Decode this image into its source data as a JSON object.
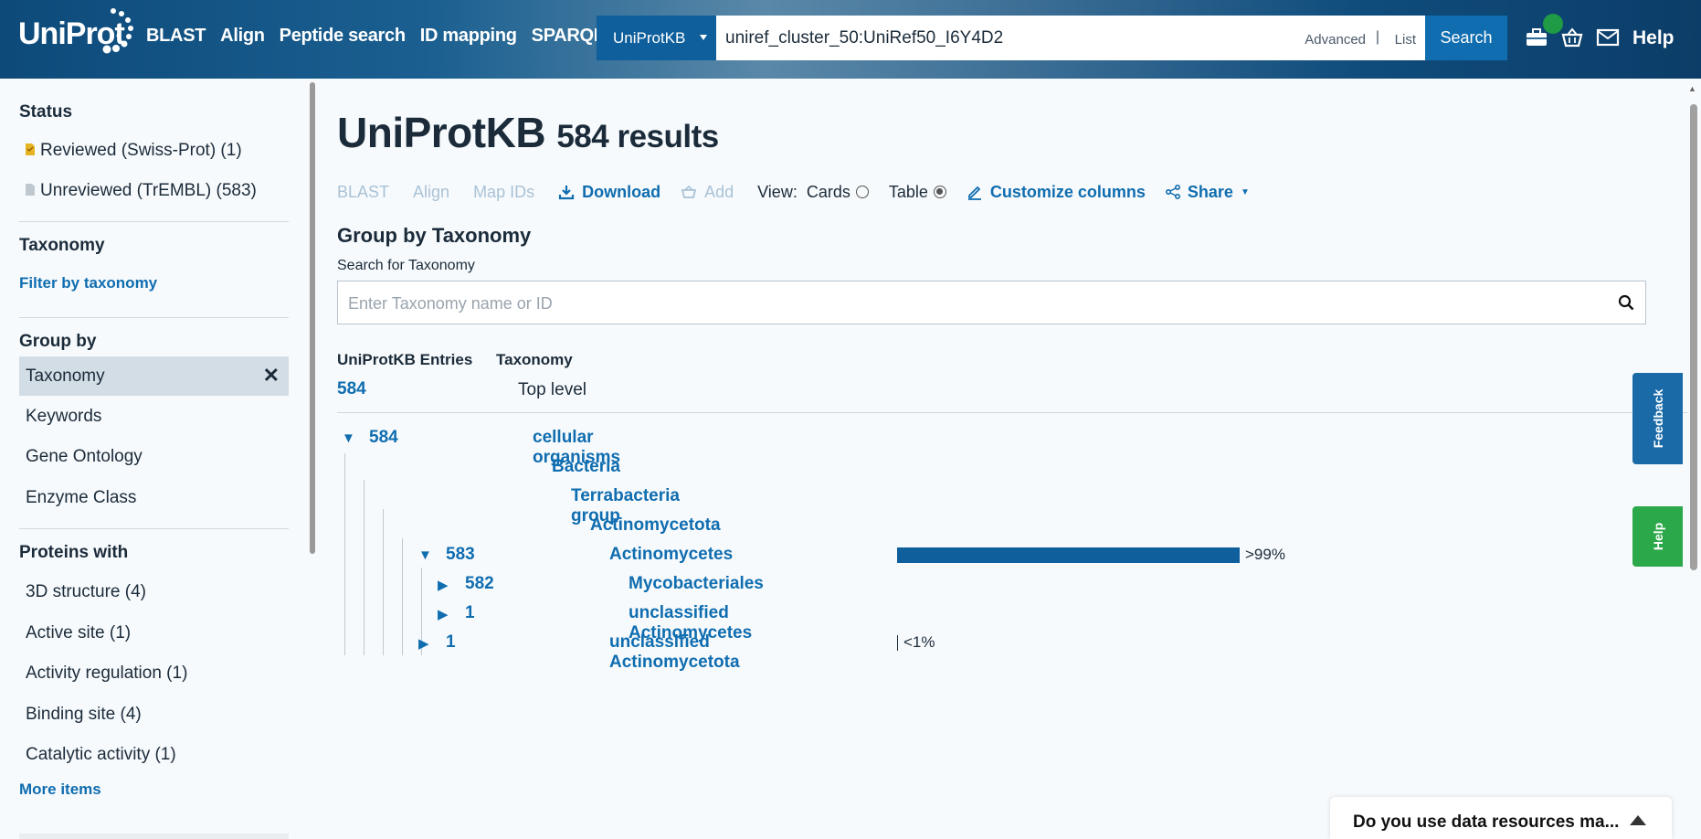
{
  "header": {
    "logo": "UniProt",
    "nav": [
      "BLAST",
      "Align",
      "Peptide search",
      "ID mapping",
      "SPARQL"
    ],
    "database": "UniProtKB",
    "query": "uniref_cluster_50:UniRef50_I6Y4D2",
    "advanced": "Advanced",
    "separator": "|",
    "list": "List",
    "search_button": "Search",
    "help": "Help",
    "icons": [
      "toolkit-icon",
      "basket-icon",
      "mail-icon"
    ]
  },
  "sidebar": {
    "status_heading": "Status",
    "status_items": [
      "Reviewed (Swiss-Prot) (1)",
      "Unreviewed (TrEMBL) (583)"
    ],
    "taxonomy_heading": "Taxonomy",
    "filter_link": "Filter by taxonomy",
    "group_by_heading": "Group by",
    "group_by_active": "Taxonomy",
    "group_by_items": [
      "Keywords",
      "Gene Ontology",
      "Enzyme Class"
    ],
    "proteins_heading": "Proteins with",
    "protein_items": [
      "3D structure (4)",
      "Active site (1)",
      "Activity regulation (1)",
      "Binding site (4)",
      "Catalytic activity (1)"
    ],
    "more_items": "More items"
  },
  "main": {
    "title": "UniProtKB",
    "results": "584 results",
    "toolbar": {
      "blast": "BLAST",
      "align": "Align",
      "map_ids": "Map IDs",
      "download": "Download",
      "add": "Add",
      "view": "View:",
      "cards": "Cards",
      "table": "Table",
      "customize": "Customize columns",
      "share": "Share"
    },
    "group_heading": "Group by Taxonomy",
    "search_label": "Search for Taxonomy",
    "search_placeholder": "Enter Taxonomy name or ID",
    "col_entries": "UniProtKB Entries",
    "col_taxonomy": "Taxonomy",
    "top_count": "584",
    "top_level": "Top level",
    "tree": [
      {
        "count": "584",
        "name": "cellular organisms",
        "toggle": "▼"
      },
      {
        "count": "",
        "name": "Bacteria",
        "toggle": ""
      },
      {
        "count": "",
        "name": "Terrabacteria group",
        "toggle": ""
      },
      {
        "count": "",
        "name": "Actinomycetota",
        "toggle": ""
      },
      {
        "count": "583",
        "name": "Actinomycetes",
        "toggle": "▼",
        "pct_label": ">99%",
        "fraction": 0.998
      },
      {
        "count": "582",
        "name": "Mycobacteriales",
        "toggle": "▶"
      },
      {
        "count": "1",
        "name": "unclassified Actinomycetes",
        "toggle": "▶"
      },
      {
        "count": "1",
        "name": "unclassified Actinomycetota",
        "toggle": "▶",
        "pct_label": "<1%",
        "fraction": 0.002
      }
    ]
  },
  "side_tabs": {
    "feedback": "Feedback",
    "help": "Help"
  },
  "popup": {
    "text": "Do you use data resources ma..."
  },
  "colors": {
    "brand": "#0f6db0",
    "bar": "#0f5f9c",
    "feedback": "#1a6aa8",
    "help_tab": "#2ba84a"
  }
}
